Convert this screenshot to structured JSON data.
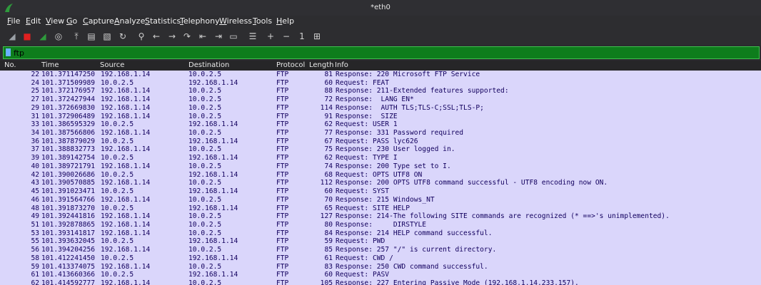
{
  "window": {
    "title": "*eth0"
  },
  "menu": [
    "File",
    "Edit",
    "View",
    "Go",
    "Capture",
    "Analyze",
    "Statistics",
    "Telephony",
    "Wireless",
    "Tools",
    "Help"
  ],
  "toolbar": [
    {
      "icon": "shark-fin-icon",
      "glyph": "◢"
    },
    {
      "icon": "stop-capture-icon",
      "glyph": "■"
    },
    {
      "icon": "restart-capture-icon",
      "glyph": "◢"
    },
    {
      "icon": "capture-options-icon",
      "glyph": "◎"
    },
    {
      "icon": "open-file-icon",
      "glyph": "⤒"
    },
    {
      "icon": "save-file-icon",
      "glyph": "▤"
    },
    {
      "icon": "close-file-icon",
      "glyph": "▧"
    },
    {
      "icon": "reload-file-icon",
      "glyph": "↻"
    },
    {
      "icon": "find-packet-icon",
      "glyph": "⚲"
    },
    {
      "icon": "go-back-icon",
      "glyph": "←"
    },
    {
      "icon": "go-forward-icon",
      "glyph": "→"
    },
    {
      "icon": "go-to-packet-icon",
      "glyph": "↷"
    },
    {
      "icon": "first-packet-icon",
      "glyph": "⇤"
    },
    {
      "icon": "last-packet-icon",
      "glyph": "⇥"
    },
    {
      "icon": "auto-scroll-icon",
      "glyph": "▭"
    },
    {
      "icon": "colorize-icon",
      "glyph": "☰"
    },
    {
      "icon": "zoom-in-icon",
      "glyph": "+"
    },
    {
      "icon": "zoom-out-icon",
      "glyph": "−"
    },
    {
      "icon": "normal-size-icon",
      "glyph": "1"
    },
    {
      "icon": "resize-columns-icon",
      "glyph": "⊞"
    }
  ],
  "filter": {
    "value": "ftp"
  },
  "columns": [
    "No.",
    "Time",
    "Source",
    "Destination",
    "Protocol",
    "Length",
    "Info"
  ],
  "packets": [
    {
      "no": "22",
      "time": "101.371147250",
      "src": "192.168.1.14",
      "dst": "10.0.2.5",
      "proto": "FTP",
      "len": "81",
      "info": "Response: 220 Microsoft FTP Service"
    },
    {
      "no": "24",
      "time": "101.371509989",
      "src": "10.0.2.5",
      "dst": "192.168.1.14",
      "proto": "FTP",
      "len": "60",
      "info": "Request: FEAT"
    },
    {
      "no": "25",
      "time": "101.372176957",
      "src": "192.168.1.14",
      "dst": "10.0.2.5",
      "proto": "FTP",
      "len": "88",
      "info": "Response: 211-Extended features supported:"
    },
    {
      "no": "27",
      "time": "101.372427944",
      "src": "192.168.1.14",
      "dst": "10.0.2.5",
      "proto": "FTP",
      "len": "72",
      "info": "Response:  LANG EN*"
    },
    {
      "no": "29",
      "time": "101.372669830",
      "src": "192.168.1.14",
      "dst": "10.0.2.5",
      "proto": "FTP",
      "len": "114",
      "info": "Response:  AUTH TLS;TLS-C;SSL;TLS-P;"
    },
    {
      "no": "31",
      "time": "101.372906489",
      "src": "192.168.1.14",
      "dst": "10.0.2.5",
      "proto": "FTP",
      "len": "91",
      "info": "Response:  SIZE"
    },
    {
      "no": "33",
      "time": "101.386595329",
      "src": "10.0.2.5",
      "dst": "192.168.1.14",
      "proto": "FTP",
      "len": "62",
      "info": "Request: USER 1"
    },
    {
      "no": "34",
      "time": "101.387566806",
      "src": "192.168.1.14",
      "dst": "10.0.2.5",
      "proto": "FTP",
      "len": "77",
      "info": "Response: 331 Password required"
    },
    {
      "no": "36",
      "time": "101.387879029",
      "src": "10.0.2.5",
      "dst": "192.168.1.14",
      "proto": "FTP",
      "len": "67",
      "info": "Request: PASS lyc626"
    },
    {
      "no": "37",
      "time": "101.388832773",
      "src": "192.168.1.14",
      "dst": "10.0.2.5",
      "proto": "FTP",
      "len": "75",
      "info": "Response: 230 User logged in."
    },
    {
      "no": "39",
      "time": "101.389142754",
      "src": "10.0.2.5",
      "dst": "192.168.1.14",
      "proto": "FTP",
      "len": "62",
      "info": "Request: TYPE I"
    },
    {
      "no": "40",
      "time": "101.389721791",
      "src": "192.168.1.14",
      "dst": "10.0.2.5",
      "proto": "FTP",
      "len": "74",
      "info": "Response: 200 Type set to I."
    },
    {
      "no": "42",
      "time": "101.390026686",
      "src": "10.0.2.5",
      "dst": "192.168.1.14",
      "proto": "FTP",
      "len": "68",
      "info": "Request: OPTS UTF8 ON"
    },
    {
      "no": "43",
      "time": "101.390570885",
      "src": "192.168.1.14",
      "dst": "10.0.2.5",
      "proto": "FTP",
      "len": "112",
      "info": "Response: 200 OPTS UTF8 command successful - UTF8 encoding now ON."
    },
    {
      "no": "45",
      "time": "101.391023471",
      "src": "10.0.2.5",
      "dst": "192.168.1.14",
      "proto": "FTP",
      "len": "60",
      "info": "Request: SYST"
    },
    {
      "no": "46",
      "time": "101.391564766",
      "src": "192.168.1.14",
      "dst": "10.0.2.5",
      "proto": "FTP",
      "len": "70",
      "info": "Response: 215 Windows_NT"
    },
    {
      "no": "48",
      "time": "101.391873270",
      "src": "10.0.2.5",
      "dst": "192.168.1.14",
      "proto": "FTP",
      "len": "65",
      "info": "Request: SITE HELP"
    },
    {
      "no": "49",
      "time": "101.392441816",
      "src": "192.168.1.14",
      "dst": "10.0.2.5",
      "proto": "FTP",
      "len": "127",
      "info": "Response: 214-The following SITE commands are recognized (* ==>'s unimplemented)."
    },
    {
      "no": "51",
      "time": "101.392878865",
      "src": "192.168.1.14",
      "dst": "10.0.2.5",
      "proto": "FTP",
      "len": "80",
      "info": "Response:     DIRSTYLE"
    },
    {
      "no": "53",
      "time": "101.393141817",
      "src": "192.168.1.14",
      "dst": "10.0.2.5",
      "proto": "FTP",
      "len": "84",
      "info": "Response: 214 HELP command successful."
    },
    {
      "no": "55",
      "time": "101.393632045",
      "src": "10.0.2.5",
      "dst": "192.168.1.14",
      "proto": "FTP",
      "len": "59",
      "info": "Request: PWD"
    },
    {
      "no": "56",
      "time": "101.394204256",
      "src": "192.168.1.14",
      "dst": "10.0.2.5",
      "proto": "FTP",
      "len": "85",
      "info": "Response: 257 \"/\" is current directory."
    },
    {
      "no": "58",
      "time": "101.412241450",
      "src": "10.0.2.5",
      "dst": "192.168.1.14",
      "proto": "FTP",
      "len": "61",
      "info": "Request: CWD /"
    },
    {
      "no": "59",
      "time": "101.413374075",
      "src": "192.168.1.14",
      "dst": "10.0.2.5",
      "proto": "FTP",
      "len": "83",
      "info": "Response: 250 CWD command successful."
    },
    {
      "no": "61",
      "time": "101.413660366",
      "src": "10.0.2.5",
      "dst": "192.168.1.14",
      "proto": "FTP",
      "len": "60",
      "info": "Request: PASV"
    },
    {
      "no": "62",
      "time": "101.414592777",
      "src": "192.168.1.14",
      "dst": "10.0.2.5",
      "proto": "FTP",
      "len": "105",
      "info": "Response: 227 Entering Passive Mode (192,168,1,14,233,157)."
    }
  ]
}
